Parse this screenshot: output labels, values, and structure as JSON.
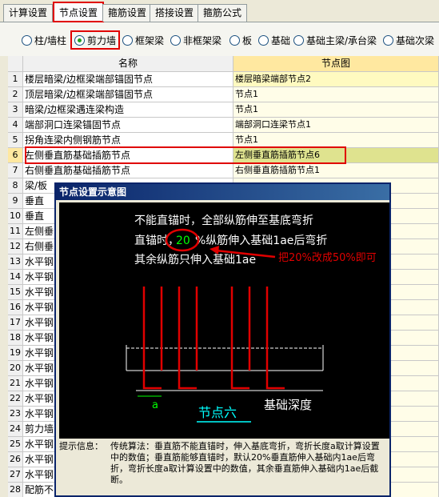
{
  "tabs": [
    "计算设置",
    "节点设置",
    "箍筋设置",
    "搭接设置",
    "箍筋公式"
  ],
  "radios": [
    "柱/墙柱",
    "剪力墙",
    "框架梁",
    "非框架梁",
    "板",
    "基础",
    "基础主梁/承台梁",
    "基础次梁"
  ],
  "grid": {
    "col_name": "名称",
    "col_node": "节点图",
    "rows": [
      {
        "n": "1",
        "name": "楼层暗梁/边框梁端部锚固节点",
        "node": "楼层暗梁端部节点2"
      },
      {
        "n": "2",
        "name": "顶层暗梁/边框梁端部锚固节点",
        "node": "节点1"
      },
      {
        "n": "3",
        "name": "暗梁/边框梁遇连梁构造",
        "node": "节点1"
      },
      {
        "n": "4",
        "name": "端部洞口连梁锚固节点",
        "node": "端部洞口连梁节点1"
      },
      {
        "n": "5",
        "name": "拐角连梁内侧钢筋节点",
        "node": "节点1"
      },
      {
        "n": "6",
        "name": "左侧垂直筋基础插筋节点",
        "node": "左侧垂直筋插筋节点6"
      },
      {
        "n": "7",
        "name": "右侧垂直筋基础插筋节点",
        "node": "右侧垂直筋插筋节点1"
      },
      {
        "n": "8",
        "name": "梁/板",
        "node": ""
      },
      {
        "n": "9",
        "name": "垂直",
        "node": ""
      },
      {
        "n": "10",
        "name": "垂直",
        "node": ""
      },
      {
        "n": "11",
        "name": "左侧垂",
        "node": ""
      },
      {
        "n": "12",
        "name": "右侧垂",
        "node": ""
      },
      {
        "n": "13",
        "name": "水平钢",
        "node": ""
      },
      {
        "n": "14",
        "name": "水平钢",
        "node": ""
      },
      {
        "n": "15",
        "name": "水平钢",
        "node": ""
      },
      {
        "n": "16",
        "name": "水平钢",
        "node": ""
      },
      {
        "n": "17",
        "name": "水平钢",
        "node": ""
      },
      {
        "n": "18",
        "name": "水平钢",
        "node": ""
      },
      {
        "n": "19",
        "name": "水平钢",
        "node": ""
      },
      {
        "n": "20",
        "name": "水平钢",
        "node": ""
      },
      {
        "n": "21",
        "name": "水平钢",
        "node": ""
      },
      {
        "n": "22",
        "name": "水平钢",
        "node": ""
      },
      {
        "n": "23",
        "name": "水平钢",
        "node": ""
      },
      {
        "n": "24",
        "name": "剪力墙",
        "node": ""
      },
      {
        "n": "25",
        "name": "水平钢",
        "node": ""
      },
      {
        "n": "26",
        "name": "水平钢",
        "node": ""
      },
      {
        "n": "27",
        "name": "水平钢",
        "node": ""
      },
      {
        "n": "28",
        "name": "配筋不",
        "node": ""
      }
    ]
  },
  "dialog": {
    "title": "节点设置示意图",
    "line1": "不能直锚时，全部纵筋伸至基底弯折",
    "line2_a": "直锚时，",
    "line2_value": "20",
    "line2_b": "%纵筋伸入基础1ae后弯折",
    "line3": "其余纵筋只伸入基础1ae",
    "annotation": "把20%改成50%即可",
    "label_a": "a",
    "node_name": "节点六",
    "depth_label": "基础深度",
    "hint_label": "提示信息：",
    "hint_text": "传统算法：垂直筋不能直锚时，伸入基底弯折，弯折长度a取计算设置中的数值；垂直筋能够直锚时，默认20%垂直筋伸入基础内1ae后弯折，弯折长度a取计算设置中的数值，其余垂直筋伸入基础内1ae后截断。"
  },
  "colors": {
    "accent_red": "#e00000",
    "green_text": "#00ff00",
    "cyan": "#00ffff",
    "rebar_red": "#e00000"
  }
}
